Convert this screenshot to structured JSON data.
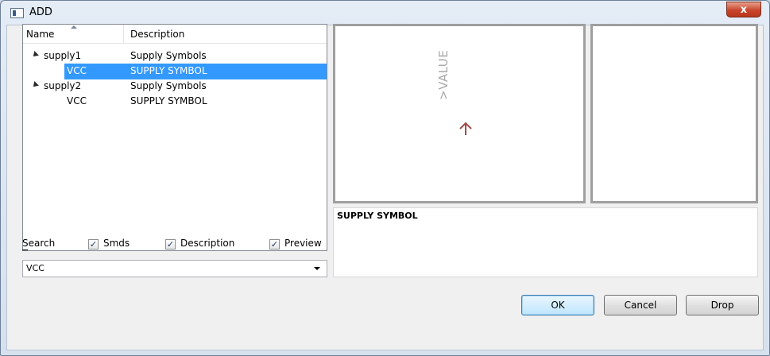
{
  "window": {
    "title": "ADD"
  },
  "titlebar": {
    "close_glyph": "x"
  },
  "tree": {
    "columns": {
      "name": "Name",
      "description": "Description"
    },
    "rows": [
      {
        "name": "supply1",
        "description": "Supply Symbols",
        "level": 0,
        "expanded": true,
        "selected": false
      },
      {
        "name": "VCC",
        "description": "SUPPLY SYMBOL",
        "level": 1,
        "selected": true
      },
      {
        "name": "supply2",
        "description": "Supply Symbols",
        "level": 0,
        "expanded": true,
        "selected": false
      },
      {
        "name": "VCC",
        "description": "SUPPLY SYMBOL",
        "level": 1,
        "selected": false
      }
    ]
  },
  "filters": {
    "search_label": "Search",
    "smds_label": "Smds",
    "smds_checked": true,
    "description_label": "Description",
    "description_checked": true,
    "preview_label": "Preview",
    "preview_checked": true
  },
  "search": {
    "value": "VCC"
  },
  "preview": {
    "symbol_value_text": ">VALUE",
    "symbol_color": "#a24a4a"
  },
  "description": {
    "text": "SUPPLY SYMBOL"
  },
  "buttons": {
    "ok": "OK",
    "cancel": "Cancel",
    "drop": "Drop"
  },
  "colors": {
    "selection": "#3399ff",
    "title_close": "#c9462c"
  }
}
